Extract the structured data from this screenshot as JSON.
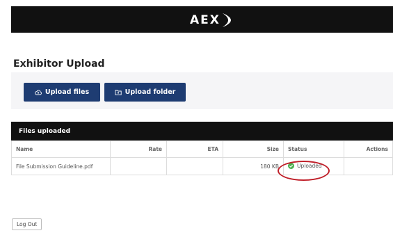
{
  "header": {
    "logo_text": "AEX",
    "logo_icon": "swoosh-chevron",
    "background": "#111111"
  },
  "page": {
    "title": "Exhibitor Upload"
  },
  "actions": {
    "upload_files_label": "Upload files",
    "upload_files_icon": "cloud-upload-icon",
    "upload_folder_label": "Upload folder",
    "upload_folder_icon": "folder-icon",
    "button_color": "#1e3c72"
  },
  "files_panel": {
    "title": "Files uploaded",
    "columns": {
      "name": "Name",
      "rate": "Rate",
      "eta": "ETA",
      "size": "Size",
      "status": "Status",
      "actions": "Actions"
    },
    "rows": [
      {
        "name": "File Submission Guideline.pdf",
        "rate": "",
        "eta": "",
        "size": "180 KB",
        "status": "Uploaded",
        "status_icon": "check-circle-icon",
        "status_color": "#4caf50",
        "actions": ""
      }
    ]
  },
  "annotation": {
    "highlight_color": "#c0202a"
  },
  "footer": {
    "logout_label": "Log Out"
  }
}
